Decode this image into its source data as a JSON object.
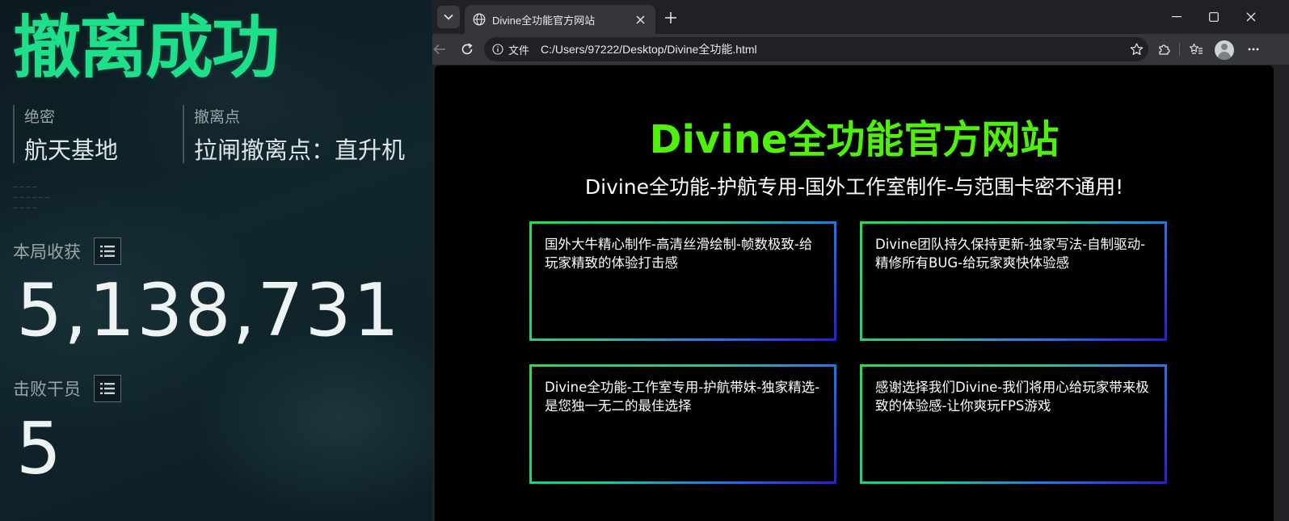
{
  "game": {
    "headline": "撤离成功",
    "difficulty_label": "绝密",
    "difficulty_value": "航天基地",
    "extract_label": "撤离点",
    "extract_value": "拉闸撤离点：直升机",
    "tiny_lines": [
      "— — — —",
      "— — — — — —",
      "— — — —"
    ],
    "loot_label": "本局收获",
    "loot_value": "5,138,731",
    "kills_label": "击败干员",
    "kills_value": "5"
  },
  "browser": {
    "tab_title": "Divine全功能官方网站",
    "url_chip": "文件",
    "url": "C:/Users/97222/Desktop/Divine全功能.html"
  },
  "page": {
    "title": "Divine全功能官方网站",
    "subtitle": "Divine全功能-护航专用-国外工作室制作-与范围卡密不通用!",
    "cards": [
      "国外大牛精心制作-高清丝滑绘制-帧数极致-给玩家精致的体验打击感",
      "Divine团队持久保持更新-独家写法-自制驱动-精修所有BUG-给玩家爽快体验感",
      "Divine全功能-工作室专用-护航带妹-独家精选-是您独一无二的最佳选择",
      "感谢选择我们Divine-我们将用心给玩家带来极致的体验感-让你爽玩FPS游戏"
    ]
  },
  "colors": {
    "game_accent": "#1fe08a",
    "site_title": "#4ef00c",
    "card_gradient_start": "#22e04a",
    "card_gradient_end": "#2b1ae0"
  },
  "icons": [
    "list-icon",
    "tab-list-icon",
    "globe-icon",
    "close-icon",
    "plus-icon",
    "minimize-icon",
    "maximize-icon",
    "back-icon",
    "reload-icon",
    "info-icon",
    "star-icon",
    "extensions-icon",
    "favorites-icon",
    "profile-icon",
    "more-icon"
  ]
}
